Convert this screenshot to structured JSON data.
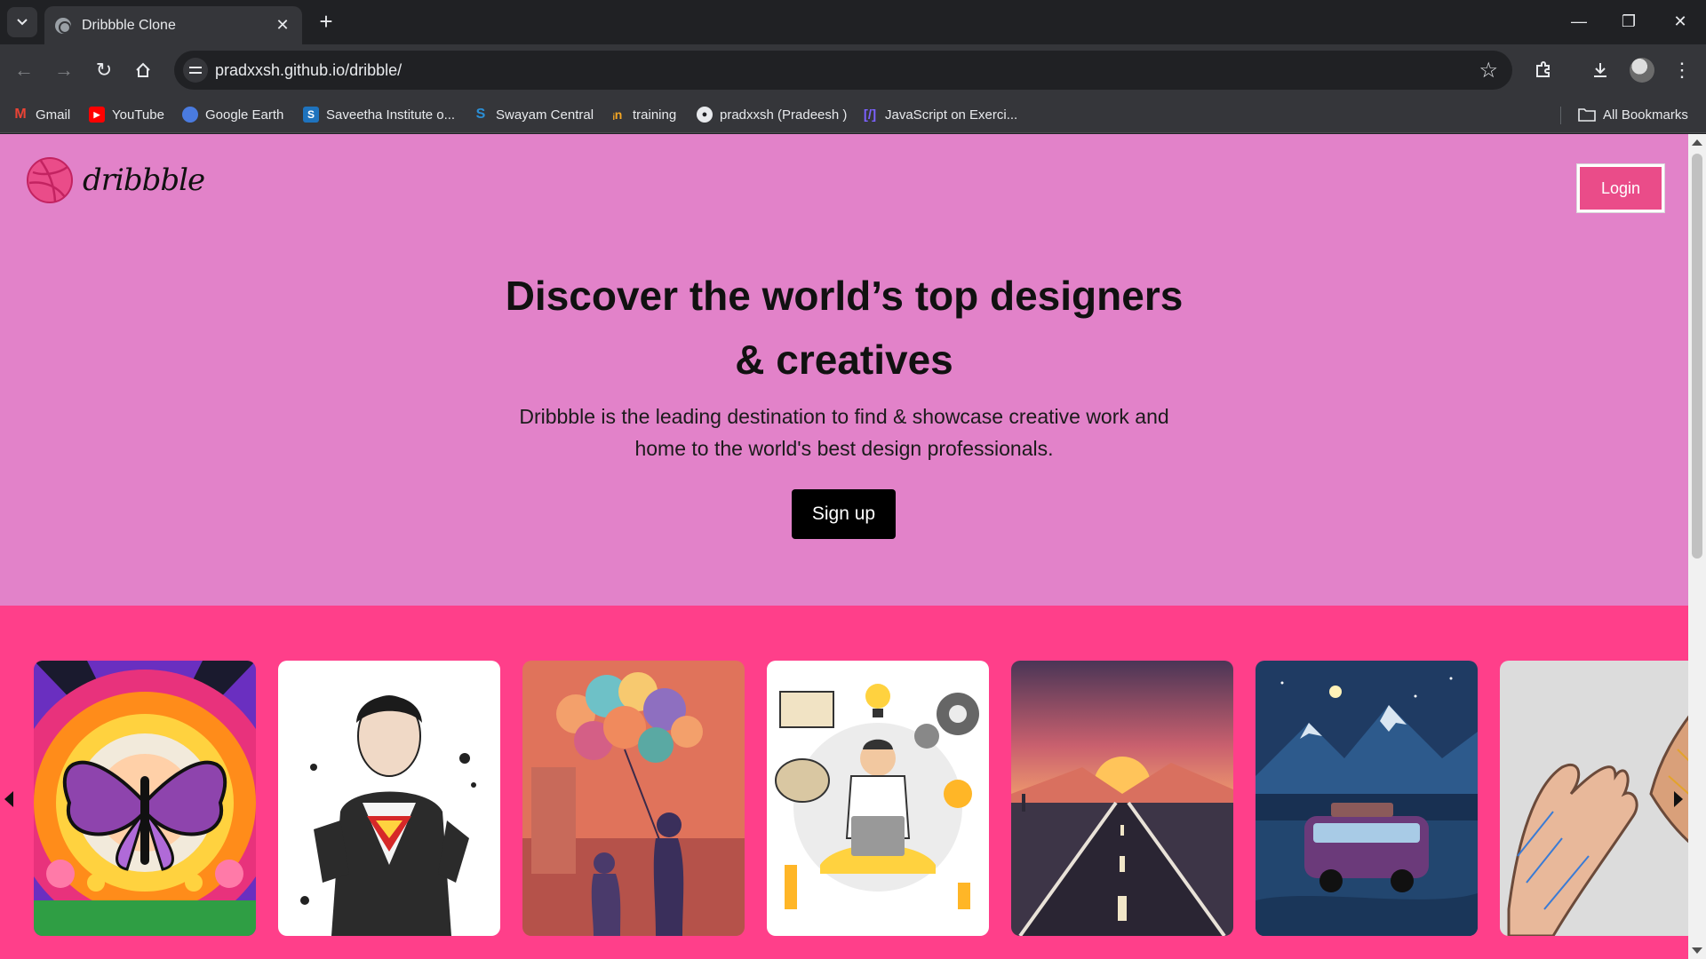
{
  "browser": {
    "tab_title": "Dribbble Clone",
    "url": "pradxxsh.github.io/dribble/",
    "bookmarks": [
      {
        "label": "Gmail",
        "icon": "gmail-icon"
      },
      {
        "label": "YouTube",
        "icon": "youtube-icon"
      },
      {
        "label": "Google Earth",
        "icon": "google-earth-icon"
      },
      {
        "label": "Saveetha Institute o...",
        "icon": "saveetha-icon"
      },
      {
        "label": "Swayam Central",
        "icon": "swayam-icon"
      },
      {
        "label": "training",
        "icon": "training-icon"
      },
      {
        "label": "pradxxsh (Pradeesh )",
        "icon": "github-icon"
      },
      {
        "label": "JavaScript on Exerci...",
        "icon": "exercism-icon"
      }
    ],
    "all_bookmarks_label": "All Bookmarks"
  },
  "page": {
    "logo_text": "dribbble",
    "login_label": "Login",
    "headline_line1": "Discover the world’s top designers",
    "headline_line2": "& creatives",
    "subtext_line1": "Dribbble is the leading destination to find & showcase creative work and",
    "subtext_line2": "home to the world's best design professionals.",
    "signup_label": "Sign up",
    "gallery": [
      {
        "name": "butterfly-rainbow-artwork"
      },
      {
        "name": "superman-sketch-artwork"
      },
      {
        "name": "balloons-street-artwork"
      },
      {
        "name": "creative-person-laptop-artwork"
      },
      {
        "name": "sunset-road-artwork"
      },
      {
        "name": "van-mountains-night-artwork"
      },
      {
        "name": "hands-sketch-artwork"
      }
    ]
  },
  "colors": {
    "hero_bg": "#e282c9",
    "brand_pink": "#ea4c89",
    "gallery_bg": "#ff3f8a"
  }
}
